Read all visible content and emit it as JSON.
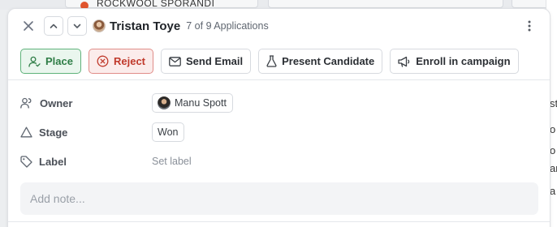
{
  "background": {
    "card_text": "ROCKWOOL SPORANDI",
    "right_fragments": [
      "st",
      "o",
      "o",
      "ar",
      "a"
    ]
  },
  "header": {
    "candidate_name": "Tristan Toye",
    "counter": "7 of 9 Applications"
  },
  "actions": {
    "place": "Place",
    "reject": "Reject",
    "send_email": "Send Email",
    "present_candidate": "Present Candidate",
    "enroll_in_campaign": "Enroll in campaign"
  },
  "fields": {
    "owner": {
      "label": "Owner",
      "value": "Manu Spott"
    },
    "stage": {
      "label": "Stage",
      "value": "Won"
    },
    "label": {
      "label": "Label",
      "value": "Set label"
    }
  },
  "note": {
    "placeholder": "Add note..."
  },
  "colors": {
    "place_accent": "#2e7d46",
    "reject_accent": "#c0392b"
  },
  "icons": [
    "close-icon",
    "chevron-up-icon",
    "chevron-down-icon",
    "more-vertical-icon",
    "user-check-icon",
    "x-circle-icon",
    "mail-icon",
    "flask-icon",
    "megaphone-icon",
    "user-group-icon",
    "stage-triangle-icon",
    "tag-icon"
  ]
}
